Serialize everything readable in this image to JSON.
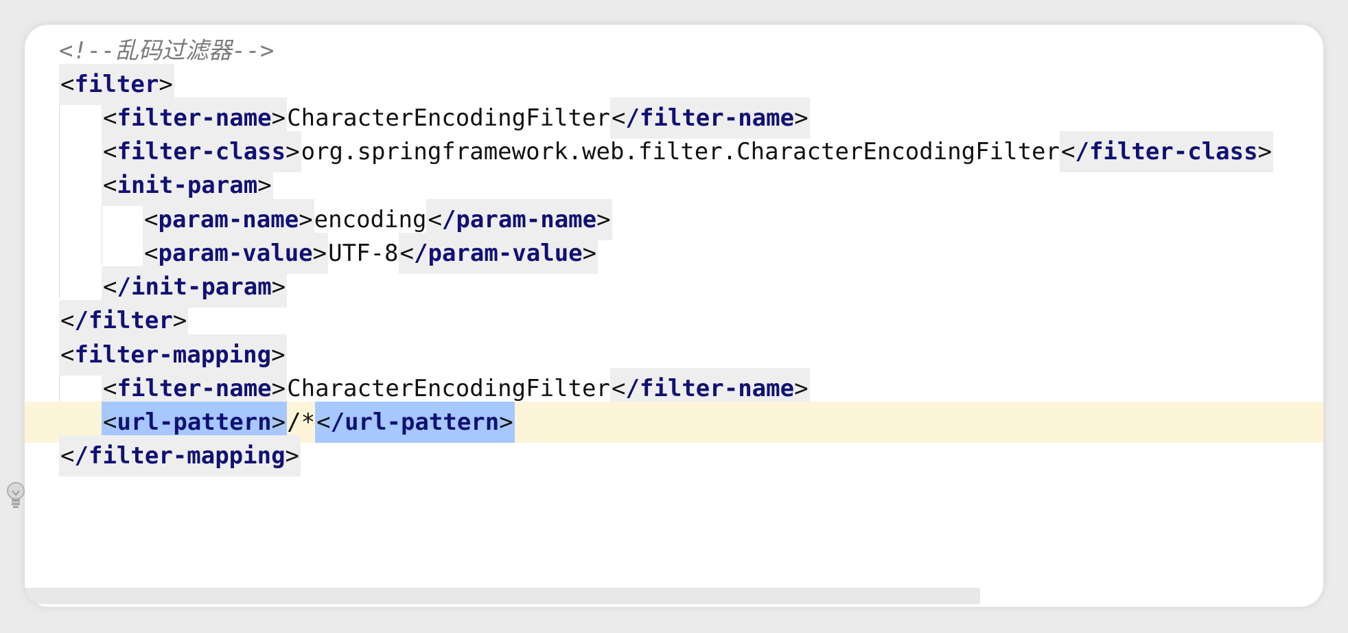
{
  "editor": {
    "hint_icon": "lightbulb-icon",
    "lines": [
      {
        "comment": "<!--乱码过滤器-->"
      },
      {
        "open": "filter"
      },
      {
        "open": "filter-name",
        "text": "CharacterEncodingFilter",
        "close": "filter-name"
      },
      {
        "open": "filter-class",
        "text": "org.springframework.web.filter.CharacterEncodingFilter",
        "close": "filter-class"
      },
      {
        "open": "init-param"
      },
      {
        "open": "param-name",
        "text": "encoding",
        "close": "param-name"
      },
      {
        "open": "param-value",
        "text": "UTF-8",
        "close": "param-value"
      },
      {
        "close": "init-param"
      },
      {
        "close": "filter"
      },
      {
        "open": "filter-mapping"
      },
      {
        "open": "filter-name",
        "text": "CharacterEncodingFilter",
        "close": "filter-name"
      },
      {
        "open": "url-pattern",
        "text": "/*",
        "close": "url-pattern"
      },
      {
        "close": "filter-mapping"
      }
    ]
  }
}
